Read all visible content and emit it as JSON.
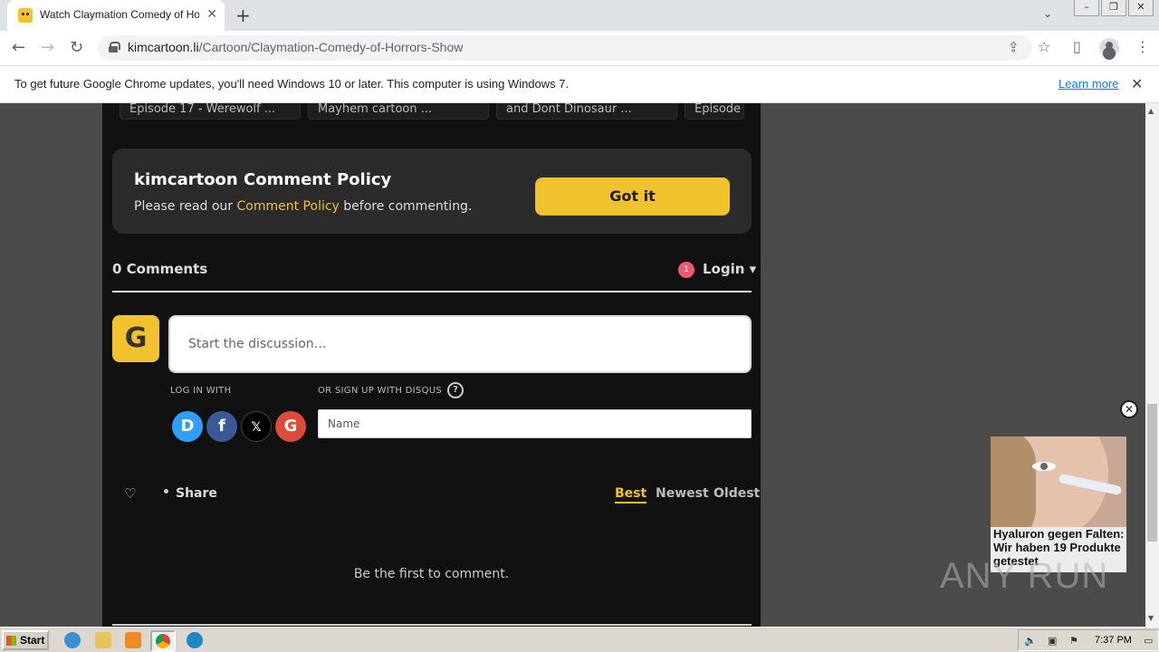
{
  "browser": {
    "tab_title": "Watch Claymation Comedy of Horrors Show",
    "url_host": "kimcartoon.li",
    "url_path": "/Cartoon/Claymation-Comedy-of-Horrors-Show"
  },
  "infobar": {
    "message": "To get future Google Chrome updates, you'll need Windows 10 or later. This computer is using Windows 7.",
    "link": "Learn more"
  },
  "episodes": [
    {
      "title": "Episode 17 - Werewolf ..."
    },
    {
      "title": "Mayhem cartoon ..."
    },
    {
      "title": "and Dont Dinosaur ..."
    },
    {
      "title": "Episode"
    }
  ],
  "policy": {
    "title": "kimcartoon Comment Policy",
    "text_before": "Please read our ",
    "link": "Comment Policy",
    "text_after": " before commenting.",
    "button": "Got it"
  },
  "comments": {
    "count_label": "0 Comments",
    "notification_count": "1",
    "login_label": "Login ▾",
    "avatar_letter": "G",
    "discussion_placeholder": "Start the discussion…",
    "log_in_with": "LOG IN WITH",
    "sign_up_with": "OR SIGN UP WITH DISQUS",
    "help_symbol": "?",
    "name_placeholder": "Name",
    "social": [
      {
        "letter": "D",
        "color": "#2e9fff"
      },
      {
        "letter": "f",
        "color": "#3b5998"
      },
      {
        "letter": "𝕏",
        "color": "#000000"
      },
      {
        "letter": "G",
        "color": "#dd4b39"
      }
    ],
    "share_label": "Share",
    "sort": {
      "best": "Best",
      "newest": "Newest",
      "oldest": "Oldest"
    },
    "empty_message": "Be the first to comment."
  },
  "ad": {
    "text": "Hyaluron gegen Falten: Wir haben 19 Produkte getestet"
  },
  "watermark": "ANY RUN",
  "taskbar": {
    "start_label": "Start",
    "clock": "7:37 PM"
  },
  "colors": {
    "accent_yellow": "#f2c12e",
    "page_bg": "#111111",
    "notification_red": "#ef5a6f"
  }
}
